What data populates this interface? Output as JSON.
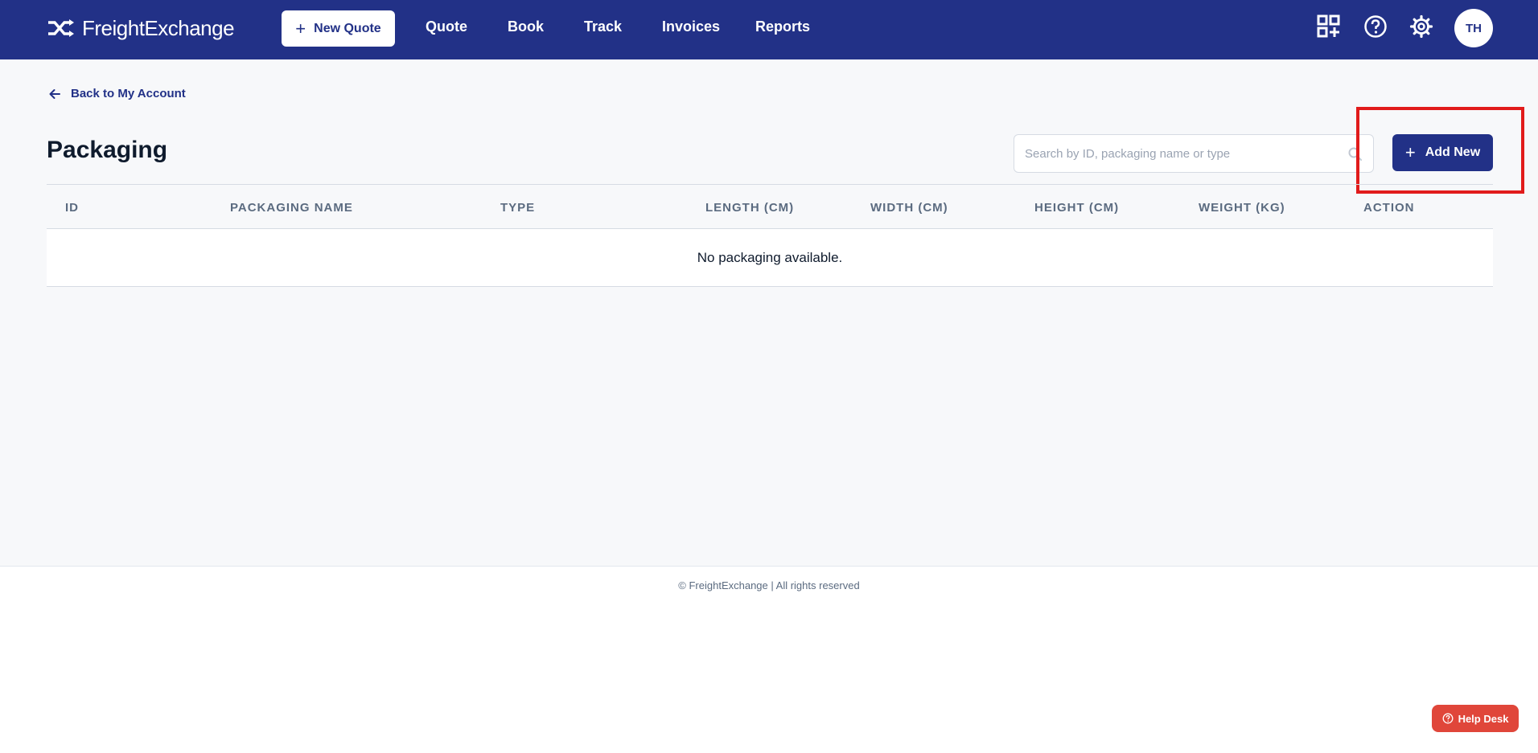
{
  "app": {
    "brand": "FreightExchange"
  },
  "topnav": {
    "new_quote_label": "New Quote",
    "links": [
      "Quote",
      "Book",
      "Track",
      "Invoices",
      "Reports"
    ],
    "icons": [
      "qr-add-icon",
      "help-circle-icon",
      "gear-icon"
    ],
    "avatar_initials": "TH"
  },
  "page": {
    "back_label": "Back to My Account",
    "title": "Packaging",
    "search_placeholder": "Search by ID, packaging name or type",
    "search_value": "",
    "add_new_label": "Add New"
  },
  "table": {
    "columns": [
      "ID",
      "PACKAGING NAME",
      "TYPE",
      "LENGTH (CM)",
      "WIDTH (CM)",
      "HEIGHT (CM)",
      "WEIGHT (KG)",
      "ACTION"
    ],
    "rows": [],
    "empty_message": "No packaging available."
  },
  "footer": {
    "text": "© FreightExchange | All rights reserved"
  },
  "help_desk_label": "Help Desk",
  "colors": {
    "brand_navy": "#223187",
    "highlight_red": "#e11b1b",
    "help_desk_red": "#e0463a"
  }
}
